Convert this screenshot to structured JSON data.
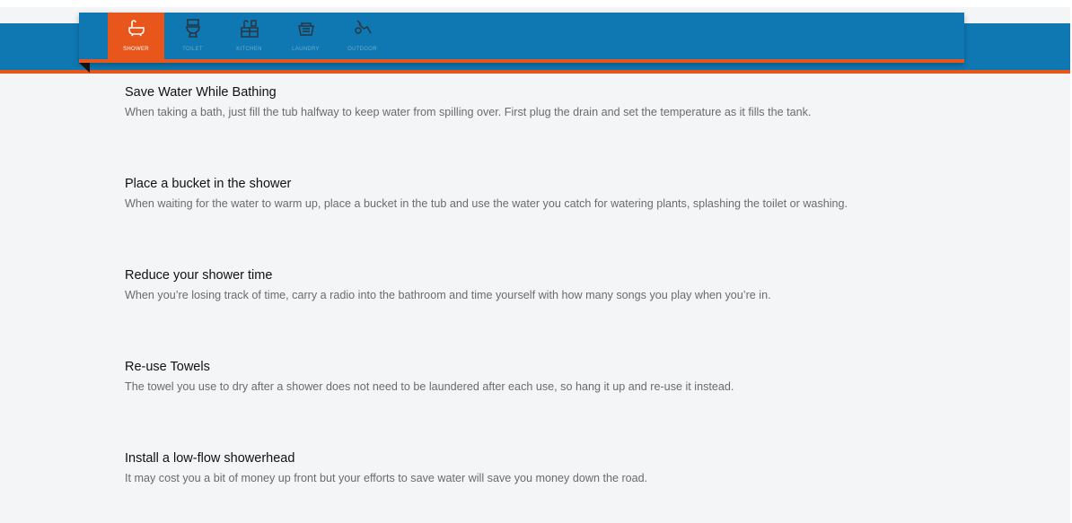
{
  "nav": {
    "tabs": [
      {
        "label": "SHOWER",
        "icon": "bathtub-icon",
        "active": true
      },
      {
        "label": "TOILET",
        "icon": "toilet-icon",
        "active": false
      },
      {
        "label": "KITCHEN",
        "icon": "kitchen-icon",
        "active": false
      },
      {
        "label": "LAUNDRY",
        "icon": "laundry-basket-icon",
        "active": false
      },
      {
        "label": "OUTDOOR",
        "icon": "hose-icon",
        "active": false
      }
    ]
  },
  "tips": [
    {
      "title": "Save Water While Bathing",
      "text": "When taking a bath, just fill the tub halfway to keep water from spilling over. First plug the drain and set the temperature as it fills the tank."
    },
    {
      "title": "Place a bucket in the shower",
      "text": "When waiting for the water to warm up, place a bucket in the tub and use the water you catch for watering plants, splashing the toilet or washing."
    },
    {
      "title": "Reduce your shower time",
      "text": "When you’re losing track of time, carry a radio into the bathroom and time yourself with how many songs you play when you’re in."
    },
    {
      "title": "Re-use Towels",
      "text": "The towel you use to dry after a shower does not need to be laundered after each use, so hang it up and re-use it instead."
    },
    {
      "title": "Install a low-flow showerhead",
      "text": "It may cost you a bit of money up front but your efforts to save water will save you money down the road."
    }
  ],
  "colors": {
    "band_blue": "#0f78b2",
    "accent_orange": "#e8561b",
    "page_bg": "#f4f5f7"
  }
}
